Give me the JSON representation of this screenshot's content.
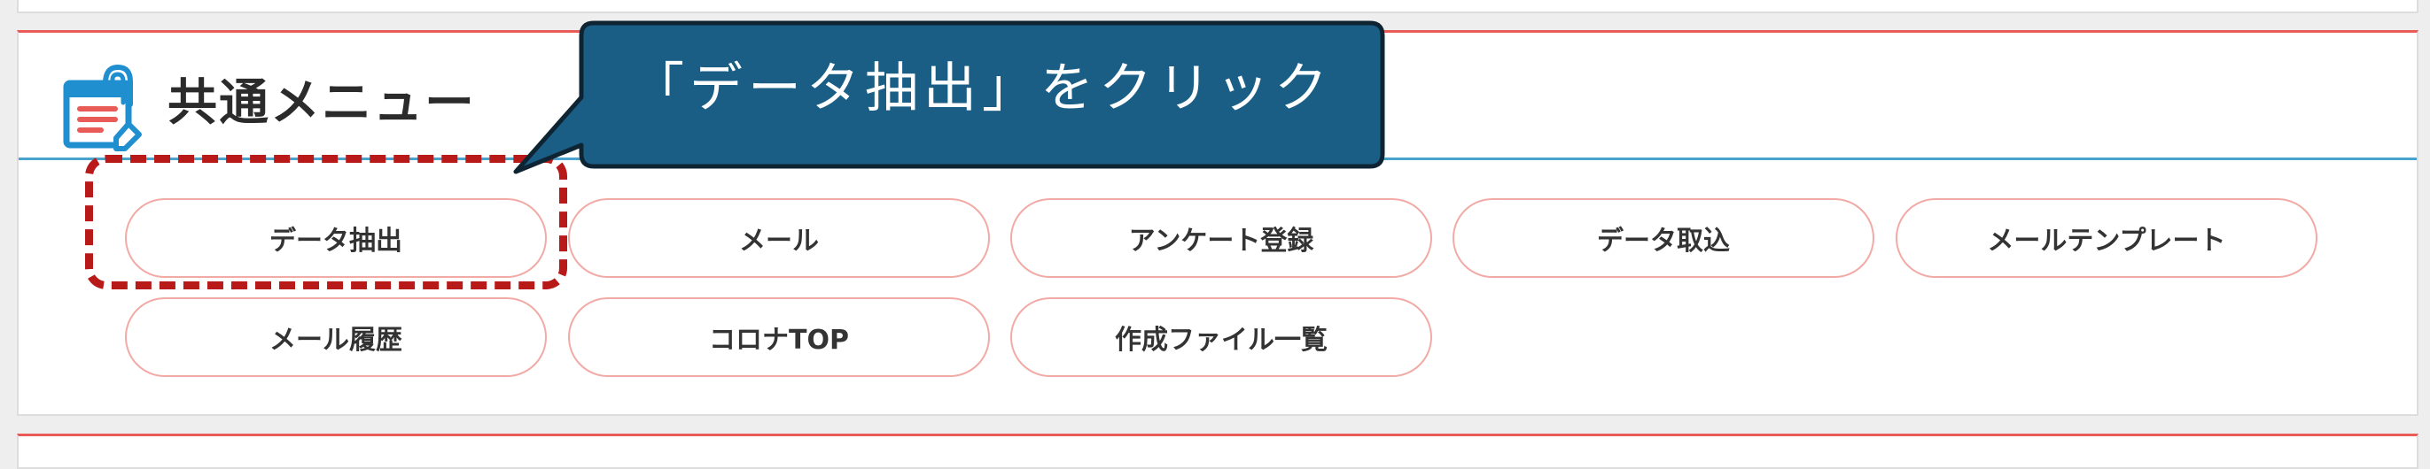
{
  "header": {
    "title": "共通メニュー",
    "icon": "notepad-icon"
  },
  "menu": {
    "buttons": [
      {
        "label": "データ抽出",
        "name": "data-extract-button"
      },
      {
        "label": "メール",
        "name": "mail-button"
      },
      {
        "label": "アンケート登録",
        "name": "survey-register-button"
      },
      {
        "label": "データ取込",
        "name": "data-import-button"
      },
      {
        "label": "メールテンプレート",
        "name": "mail-template-button"
      },
      {
        "label": "メール履歴",
        "name": "mail-history-button"
      },
      {
        "label": "コロナTOP",
        "name": "corona-top-button"
      },
      {
        "label": "作成ファイル一覧",
        "name": "file-list-button"
      }
    ]
  },
  "callout": {
    "text": "「データ抽出」をクリック"
  },
  "colors": {
    "accent_red": "#e85b57",
    "button_border": "#f2aaa6",
    "header_rule_blue": "#4aa3cc",
    "callout_fill": "#1a5e85",
    "highlight_dashed": "#b81a1a"
  }
}
